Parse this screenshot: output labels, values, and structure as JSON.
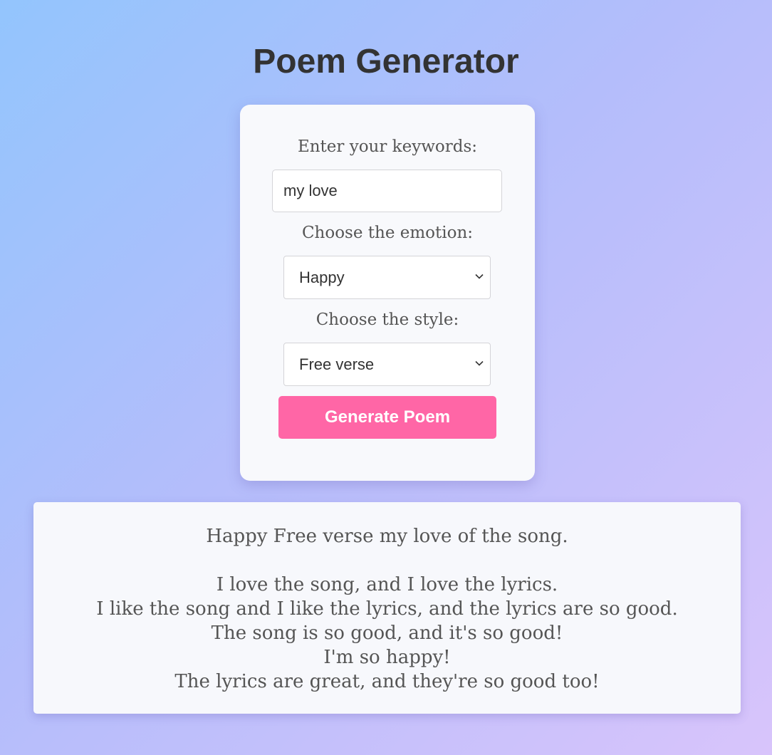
{
  "page": {
    "title": "Poem Generator"
  },
  "form": {
    "keywords_label": "Enter your keywords:",
    "keywords_value": "my love",
    "emotion_label": "Choose the emotion:",
    "emotion_selected": "Happy",
    "style_label": "Choose the style:",
    "style_selected": "Free verse",
    "generate_label": "Generate Poem"
  },
  "poem": {
    "title_line": "Happy Free verse my love of the song.",
    "lines": [
      "I love the song, and I love the lyrics.",
      "I like the song and I like the lyrics, and the lyrics are so good.",
      "The song is so good, and it's so good!",
      "I'm so happy!",
      "The lyrics are great, and they're so good too!"
    ]
  },
  "colors": {
    "accent": "#ff66a6",
    "heading": "#333333",
    "card_background": "#f8f9fc"
  },
  "icons": {
    "select_arrow": "chevron-down-icon"
  }
}
